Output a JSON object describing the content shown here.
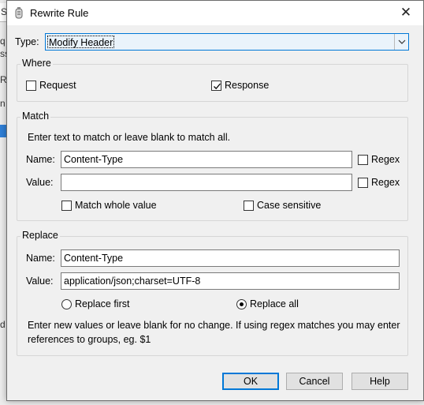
{
  "title": "Rewrite Rule",
  "type": {
    "label": "Type:",
    "value": "Modify Header"
  },
  "where": {
    "title": "Where",
    "request": {
      "label": "Request",
      "checked": false
    },
    "response": {
      "label": "Response",
      "checked": true
    }
  },
  "match": {
    "title": "Match",
    "instruction": "Enter text to match or leave blank to match all.",
    "name_label": "Name:",
    "name_value": "Content-Type",
    "value_label": "Value:",
    "value_value": "",
    "regex_label": "Regex",
    "regex_name_checked": false,
    "regex_value_checked": false,
    "whole_value_label": "Match whole value",
    "whole_value_checked": false,
    "case_label": "Case sensitive",
    "case_checked": false
  },
  "replace": {
    "title": "Replace",
    "name_label": "Name:",
    "name_value": "Content-Type",
    "value_label": "Value:",
    "value_value": "application/json;charset=UTF-8",
    "first_label": "Replace first",
    "all_label": "Replace all",
    "selected": "all",
    "note": "Enter new values or leave blank for no change. If using regex matches you may enter references to groups, eg. $1"
  },
  "buttons": {
    "ok": "OK",
    "cancel": "Cancel",
    "help": "Help"
  },
  "background_fragments": [
    "S",
    "q",
    "ss",
    "Re",
    "n",
    "d"
  ]
}
